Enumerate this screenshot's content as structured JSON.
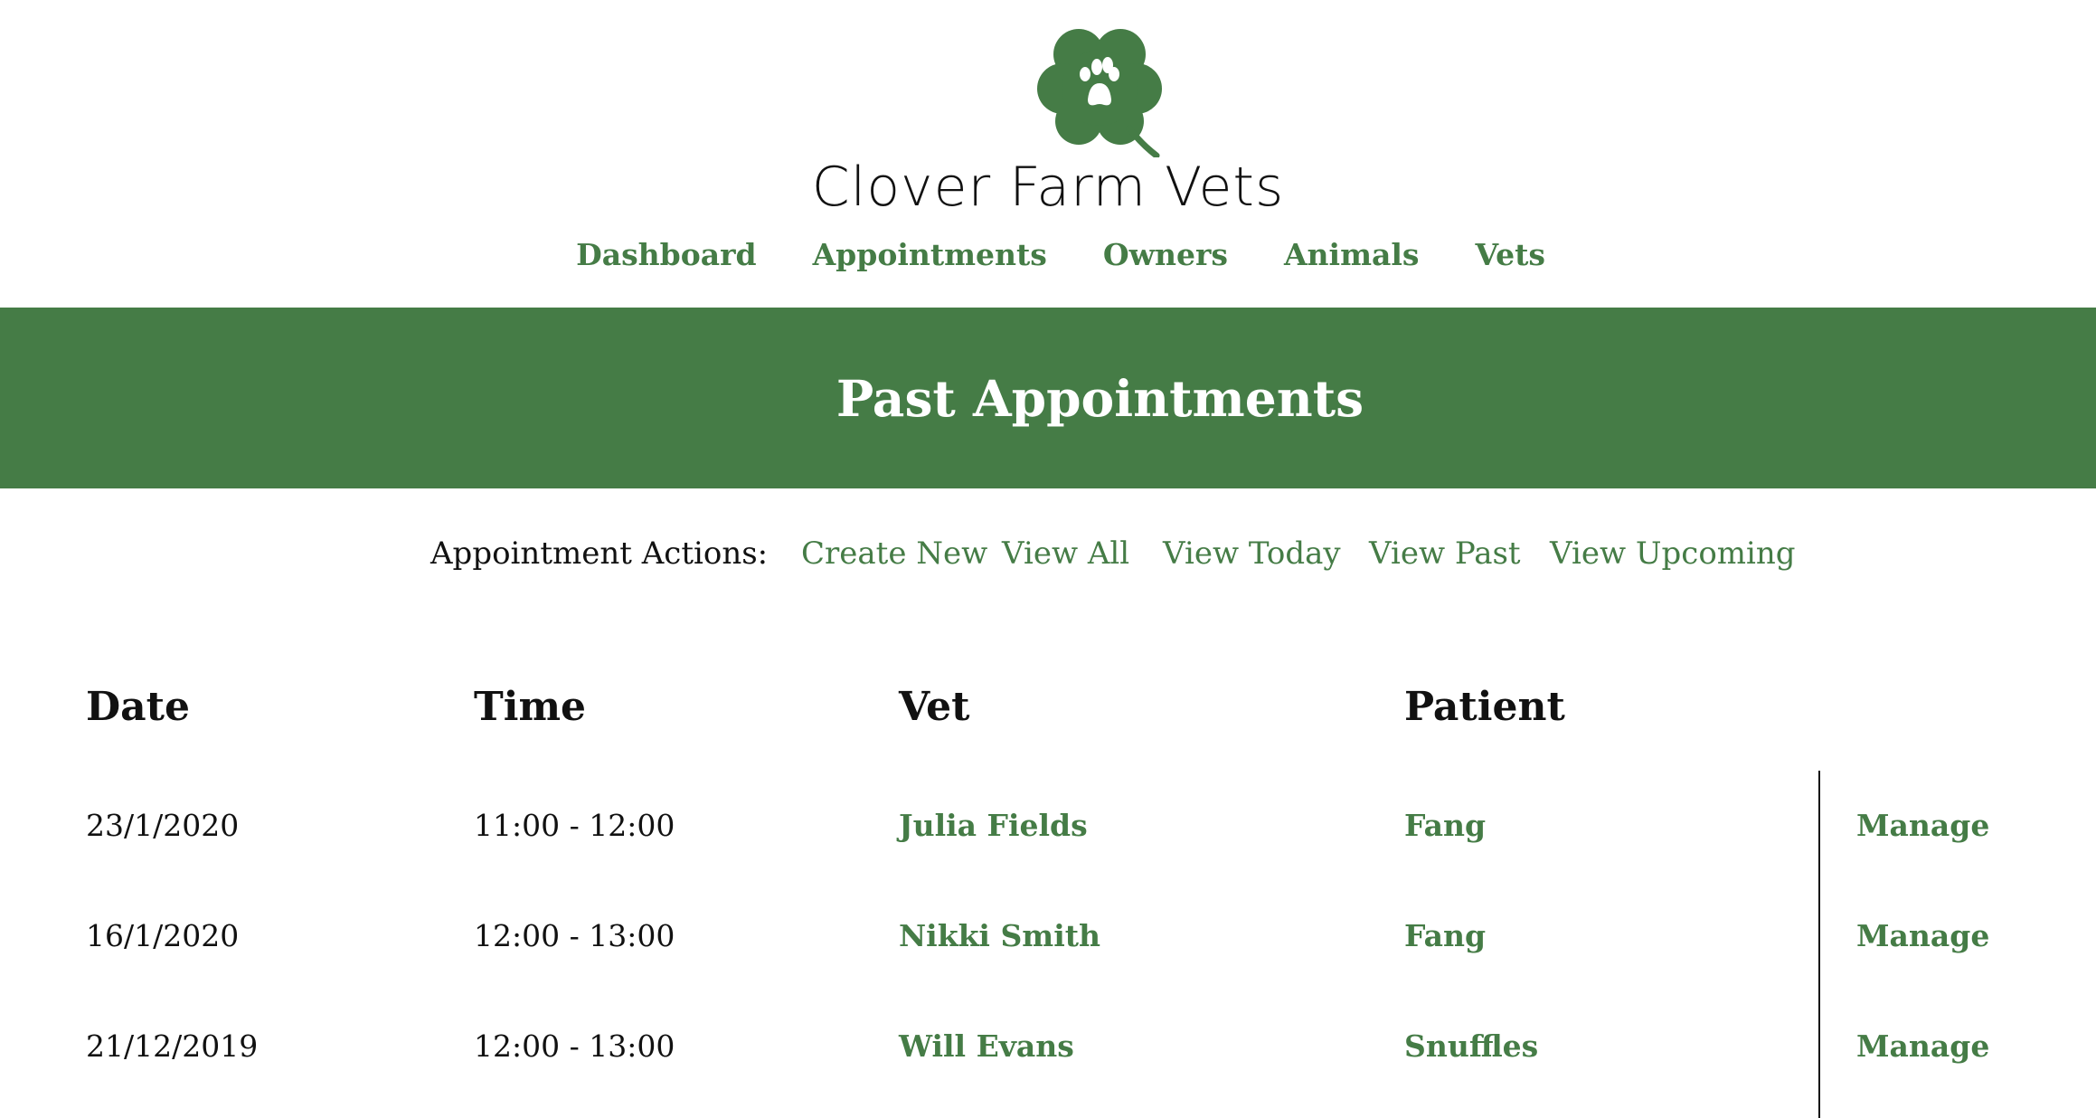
{
  "brand": {
    "name": "Clover Farm Vets",
    "logo_icon": "clover-paw-icon",
    "accent": "#457c46"
  },
  "nav": {
    "dashboard": "Dashboard",
    "appointments": "Appointments",
    "owners": "Owners",
    "animals": "Animals",
    "vets": "Vets"
  },
  "page": {
    "title": "Past Appointments"
  },
  "actions": {
    "label": "Appointment Actions:",
    "create_new": "Create New",
    "view_all": "View All",
    "view_today": "View Today",
    "view_past": "View Past",
    "view_upcoming": "View Upcoming"
  },
  "table": {
    "headers": {
      "date": "Date",
      "time": "Time",
      "vet": "Vet",
      "patient": "Patient"
    },
    "rows": [
      {
        "date": "23/1/2020",
        "time": "11:00 - 12:00",
        "vet": "Julia Fields",
        "patient": "Fang",
        "action": "Manage"
      },
      {
        "date": "16/1/2020",
        "time": "12:00 - 13:00",
        "vet": "Nikki Smith",
        "patient": "Fang",
        "action": "Manage"
      },
      {
        "date": "21/12/2019",
        "time": "12:00 - 13:00",
        "vet": "Will Evans",
        "patient": "Snuffles",
        "action": "Manage"
      }
    ]
  }
}
